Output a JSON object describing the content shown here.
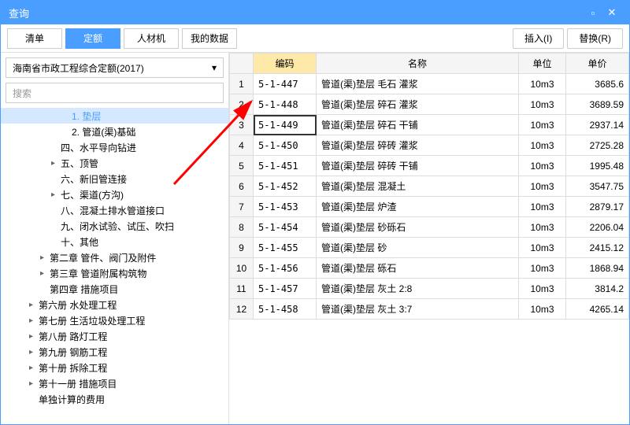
{
  "window": {
    "title": "查询"
  },
  "tabs": {
    "list": "清单",
    "quota": "定额",
    "material": "人材机",
    "mydata": "我的数据"
  },
  "actions": {
    "insert": "插入(I)",
    "replace": "替换(R)"
  },
  "dropdown": {
    "value": "海南省市政工程综合定额(2017)"
  },
  "search": {
    "placeholder": "搜索"
  },
  "tree": [
    {
      "indent": 5,
      "arrow": "",
      "label": "1. 垫层",
      "selected": true
    },
    {
      "indent": 5,
      "arrow": "",
      "label": "2. 管道(渠)基础"
    },
    {
      "indent": 4,
      "arrow": "",
      "label": "四、水平导向钻进"
    },
    {
      "indent": 4,
      "arrow": "▸",
      "label": "五、顶管"
    },
    {
      "indent": 4,
      "arrow": "",
      "label": "六、新旧管连接"
    },
    {
      "indent": 4,
      "arrow": "▸",
      "label": "七、渠道(方沟)"
    },
    {
      "indent": 4,
      "arrow": "",
      "label": "八、混凝土排水管道接口"
    },
    {
      "indent": 4,
      "arrow": "",
      "label": "九、闭水试验、试压、吹扫"
    },
    {
      "indent": 4,
      "arrow": "",
      "label": "十、其他"
    },
    {
      "indent": 3,
      "arrow": "▸",
      "label": "第二章 管件、阀门及附件"
    },
    {
      "indent": 3,
      "arrow": "▸",
      "label": "第三章 管道附属构筑物"
    },
    {
      "indent": 3,
      "arrow": "",
      "label": "第四章 措施项目"
    },
    {
      "indent": 2,
      "arrow": "▸",
      "label": "第六册 水处理工程"
    },
    {
      "indent": 2,
      "arrow": "▸",
      "label": "第七册 生活垃圾处理工程"
    },
    {
      "indent": 2,
      "arrow": "▸",
      "label": "第八册 路灯工程"
    },
    {
      "indent": 2,
      "arrow": "▸",
      "label": "第九册 钢筋工程"
    },
    {
      "indent": 2,
      "arrow": "▸",
      "label": "第十册 拆除工程"
    },
    {
      "indent": 2,
      "arrow": "▸",
      "label": "第十一册 措施项目"
    },
    {
      "indent": 2,
      "arrow": "",
      "label": "单独计算的费用"
    }
  ],
  "table": {
    "headers": {
      "code": "编码",
      "name": "名称",
      "unit": "单位",
      "price": "单价"
    },
    "rows": [
      {
        "n": 1,
        "code": "5-1-447",
        "name": "管道(渠)垫层 毛石 灌浆",
        "unit": "10m3",
        "price": "3685.6"
      },
      {
        "n": 2,
        "code": "5-1-448",
        "name": "管道(渠)垫层 碎石 灌浆",
        "unit": "10m3",
        "price": "3689.59"
      },
      {
        "n": 3,
        "code": "5-1-449",
        "name": "管道(渠)垫层 碎石 干铺",
        "unit": "10m3",
        "price": "2937.14",
        "hl": true
      },
      {
        "n": 4,
        "code": "5-1-450",
        "name": "管道(渠)垫层 碎砖 灌浆",
        "unit": "10m3",
        "price": "2725.28"
      },
      {
        "n": 5,
        "code": "5-1-451",
        "name": "管道(渠)垫层 碎砖 干铺",
        "unit": "10m3",
        "price": "1995.48"
      },
      {
        "n": 6,
        "code": "5-1-452",
        "name": "管道(渠)垫层 混凝土",
        "unit": "10m3",
        "price": "3547.75"
      },
      {
        "n": 7,
        "code": "5-1-453",
        "name": "管道(渠)垫层 炉渣",
        "unit": "10m3",
        "price": "2879.17"
      },
      {
        "n": 8,
        "code": "5-1-454",
        "name": "管道(渠)垫层 砂砾石",
        "unit": "10m3",
        "price": "2206.04"
      },
      {
        "n": 9,
        "code": "5-1-455",
        "name": "管道(渠)垫层 砂",
        "unit": "10m3",
        "price": "2415.12"
      },
      {
        "n": 10,
        "code": "5-1-456",
        "name": "管道(渠)垫层 砾石",
        "unit": "10m3",
        "price": "1868.94"
      },
      {
        "n": 11,
        "code": "5-1-457",
        "name": "管道(渠)垫层 灰土 2:8",
        "unit": "10m3",
        "price": "3814.2"
      },
      {
        "n": 12,
        "code": "5-1-458",
        "name": "管道(渠)垫层 灰土 3:7",
        "unit": "10m3",
        "price": "4265.14"
      }
    ]
  }
}
